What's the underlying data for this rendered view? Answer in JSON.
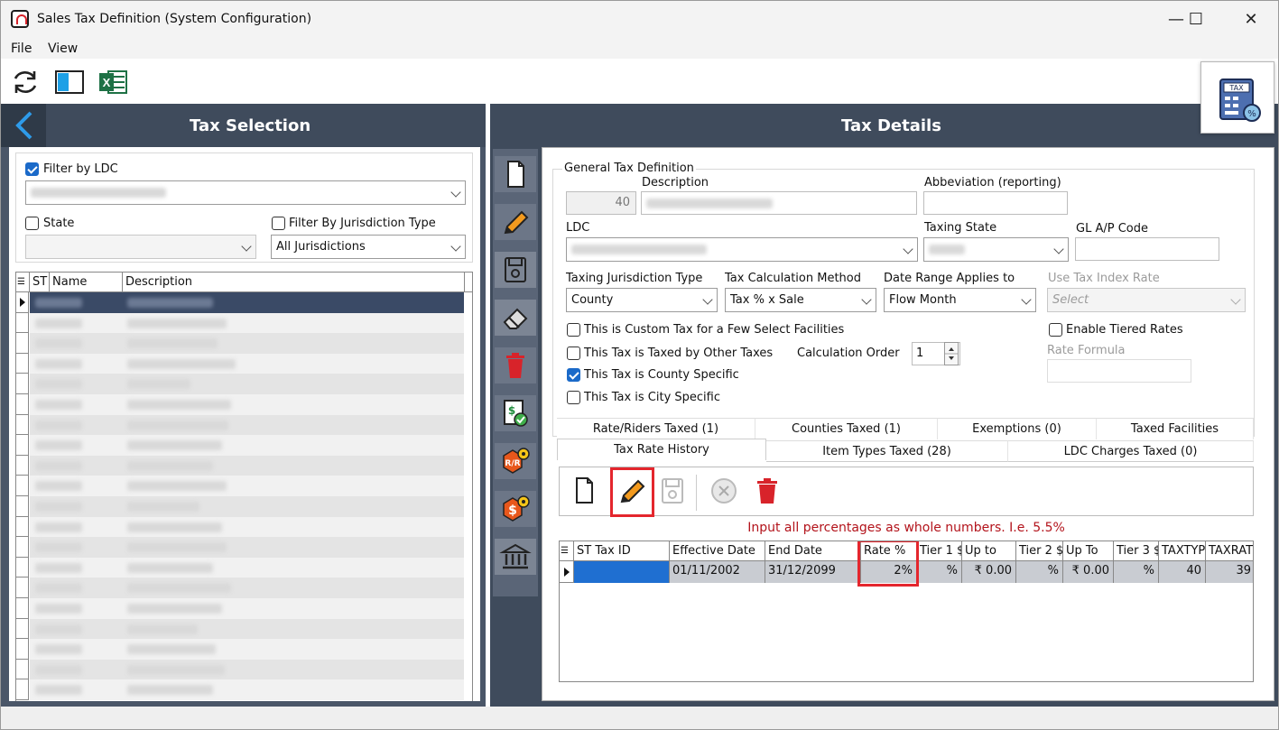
{
  "window": {
    "title": "Sales Tax Definition (System Configuration)",
    "controls": [
      "—",
      "☐",
      "✕"
    ]
  },
  "menu": [
    "File",
    "View"
  ],
  "toolbar_icons": [
    "refresh-icon",
    "panel-toggle-icon",
    "excel-icon"
  ],
  "left_panel": {
    "title": "Tax Selection",
    "filter_ldc_label": "Filter by LDC",
    "filter_ldc_checked": true,
    "state_label": "State",
    "state_checked": false,
    "filter_jurisdiction_label": "Filter By Jurisdiction Type",
    "filter_jurisdiction_checked": false,
    "jurisdiction_value": "All Jurisdictions",
    "grid_columns": [
      "ST",
      "Name",
      "Description"
    ]
  },
  "right_panel": {
    "title": "Tax Details",
    "general": {
      "group_label": "General Tax Definition",
      "id_value": "40",
      "description_label": "Description",
      "abbreviation_label": "Abbeviation (reporting)",
      "ldc_label": "LDC",
      "taxing_state_label": "Taxing State",
      "gl_label": "GL A/P Code",
      "jurisdiction_type_label": "Taxing Jurisdiction Type",
      "jurisdiction_type_value": "County",
      "calc_method_label": "Tax Calculation Method",
      "calc_method_value": "Tax % x Sale",
      "date_range_label": "Date Range Applies to",
      "date_range_value": "Flow Month",
      "use_index_label": "Use Tax Index Rate",
      "use_index_value": "Select",
      "custom_tax_label": "This is Custom Tax for a Few Select Facilities",
      "taxed_by_other_label": "This Tax is Taxed by Other Taxes",
      "calc_order_label": "Calculation Order",
      "calc_order_value": "1",
      "county_specific_label": "This Tax is County Specific",
      "city_specific_label": "This Tax is City Specific",
      "tiered_label": "Enable Tiered Rates",
      "rate_formula_label": "Rate Formula"
    },
    "tabs_row1": [
      "Rate/Riders Taxed (1)",
      "Counties Taxed (1)",
      "Exemptions (0)",
      "Taxed Facilities"
    ],
    "tabs_row2": [
      "Tax Rate History",
      "Item Types Taxed (28)",
      "LDC Charges Taxed (0)"
    ],
    "hint": "Input all percentages as whole numbers. I.e. 5.5%",
    "rate_grid": {
      "columns": [
        "ST Tax ID",
        "Effective Date",
        "End Date",
        "Rate %",
        "Tier 1 $",
        "Up to",
        "Tier 2 $",
        "Up To",
        "Tier 3 $",
        "TAXTYP",
        "TAXRAT"
      ],
      "row": [
        "",
        "01/11/2002",
        "31/12/2099",
        "2%",
        "%",
        "₹ 0.00",
        "%",
        "₹ 0.00",
        "%",
        "40",
        "39"
      ]
    }
  },
  "colors": {
    "panel_header": "#3f4b5c",
    "panel_body": "#4a5668",
    "accent_blue": "#1b6ac9",
    "highlight_red": "#e4262d",
    "hint_red": "#b3131b",
    "row_selected": "#1f6fd1"
  }
}
